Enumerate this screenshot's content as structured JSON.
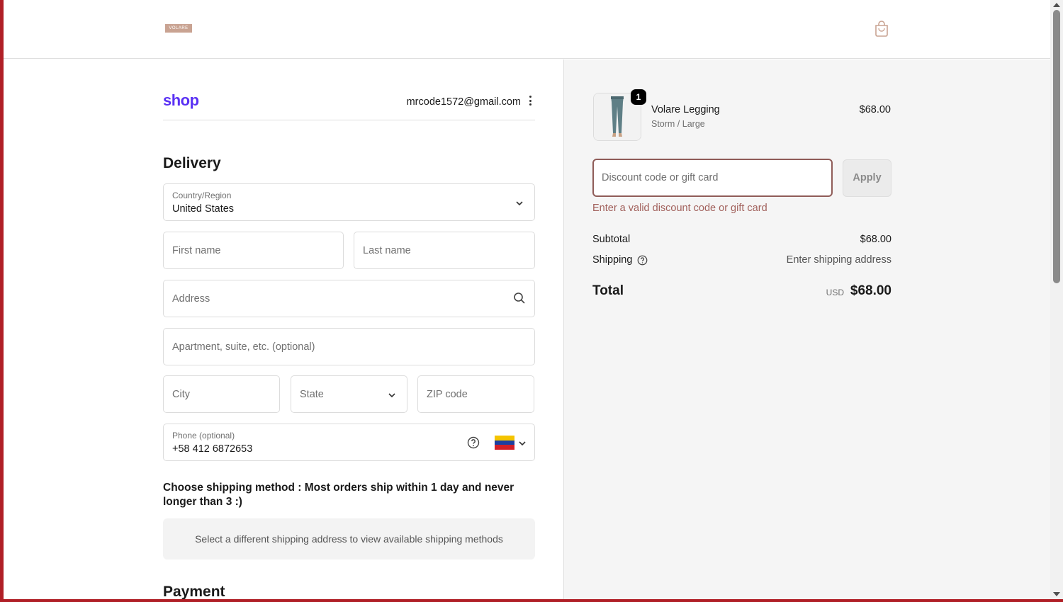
{
  "header": {
    "brand": "VOLARE"
  },
  "account": {
    "shop_logo": "shop",
    "email": "mrcode1572@gmail.com"
  },
  "delivery": {
    "title": "Delivery",
    "country_label": "Country/Region",
    "country_value": "United States",
    "first_name_placeholder": "First name",
    "last_name_placeholder": "Last name",
    "address_placeholder": "Address",
    "apartment_placeholder": "Apartment, suite, etc. (optional)",
    "city_placeholder": "City",
    "state_placeholder": "State",
    "zip_placeholder": "ZIP code",
    "phone_label": "Phone (optional)",
    "phone_value": "+58 412 6872653"
  },
  "shipping": {
    "heading": "Choose shipping method : Most orders ship within 1 day and never longer than 3 :)",
    "notice": "Select a different shipping address to view available shipping methods"
  },
  "payment": {
    "title": "Payment"
  },
  "summary": {
    "product": {
      "name": "Volare Legging",
      "variant": "Storm / Large",
      "price": "$68.00",
      "quantity": "1"
    },
    "discount_placeholder": "Discount code or gift card",
    "apply_label": "Apply",
    "discount_error": "Enter a valid discount code or gift card",
    "subtotal_label": "Subtotal",
    "subtotal_value": "$68.00",
    "shipping_label": "Shipping",
    "shipping_value": "Enter shipping address",
    "total_label": "Total",
    "total_currency": "USD",
    "total_value": "$68.00"
  },
  "colors": {
    "accent_shop": "#5a31f4",
    "error": "#a1605b",
    "window_frame": "#b01f26"
  }
}
